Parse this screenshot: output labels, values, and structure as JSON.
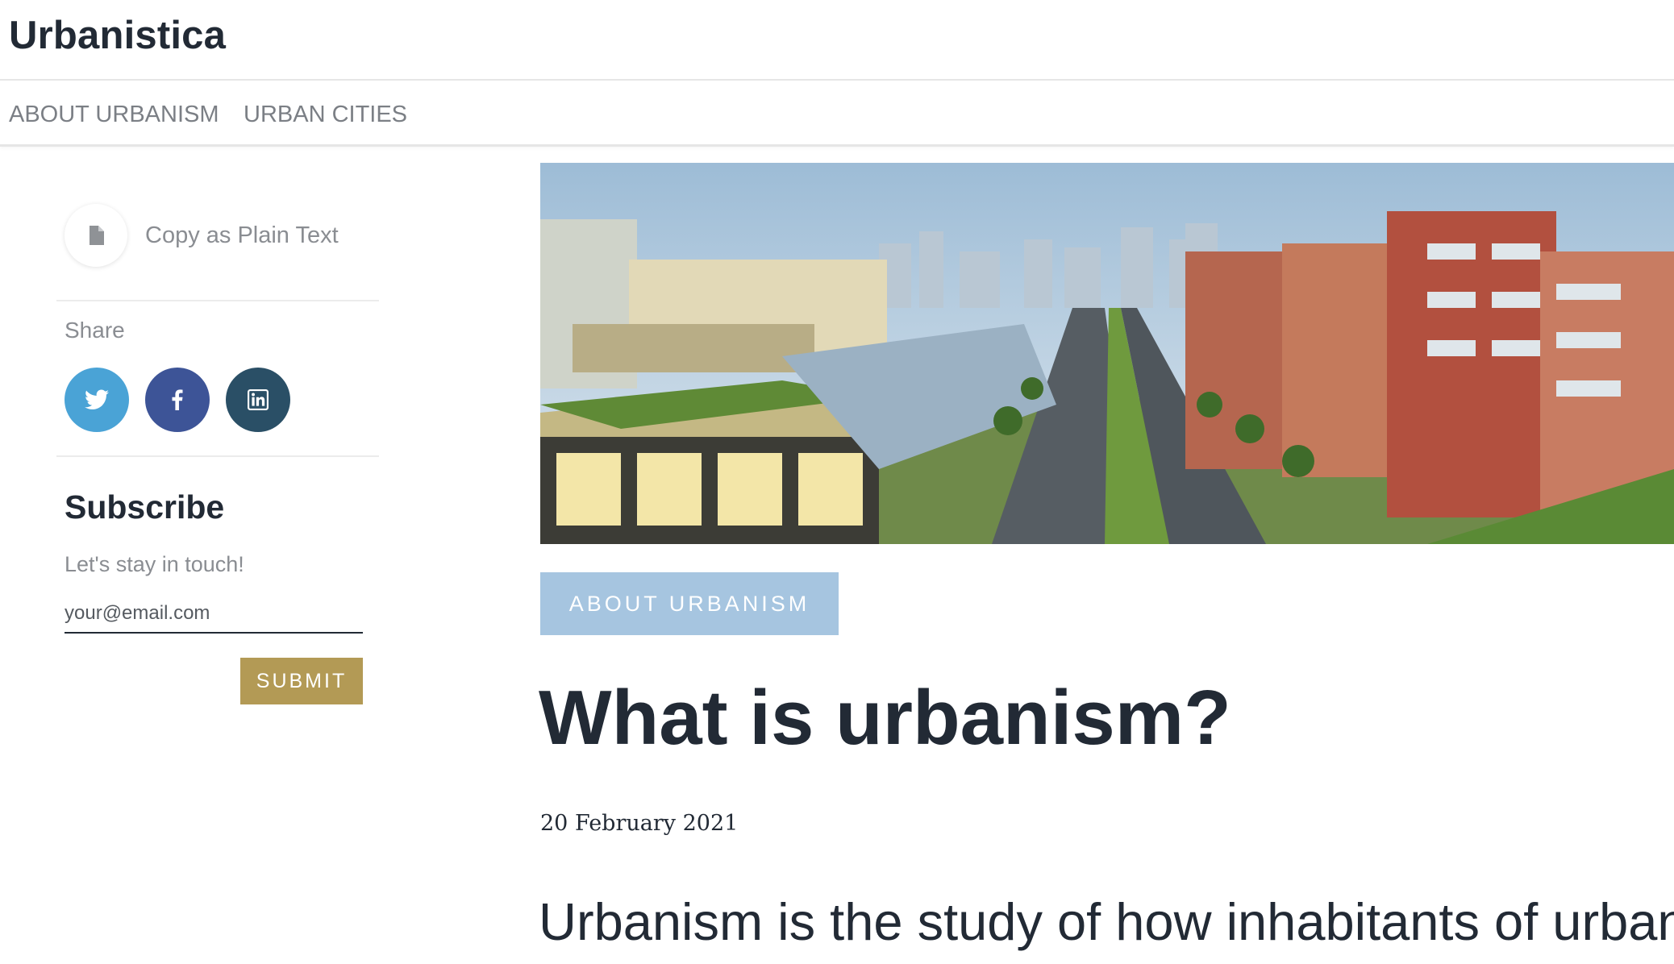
{
  "site": {
    "title": "Urbanistica"
  },
  "nav": {
    "items": [
      {
        "label": "ABOUT URBANISM"
      },
      {
        "label": "URBAN CITIES"
      }
    ]
  },
  "sidebar": {
    "copy_label": "Copy as Plain Text",
    "share_label": "Share",
    "social": [
      {
        "name": "twitter",
        "color": "#4aa3d6"
      },
      {
        "name": "facebook",
        "color": "#3d5497"
      },
      {
        "name": "linkedin",
        "color": "#2a4f66"
      }
    ],
    "subscribe": {
      "title": "Subscribe",
      "text": "Let's stay in touch!",
      "placeholder": "your@email.com",
      "submit_label": "SUBMIT"
    }
  },
  "article": {
    "category": "ABOUT URBANISM",
    "title": "What is urbanism?",
    "date": "20 February 2021",
    "lead": "Urbanism is the study of how inhabitants of urban areas"
  },
  "colors": {
    "brand_text": "#222a35",
    "badge_bg": "#a6c5e0",
    "submit_bg": "#b39a55"
  }
}
